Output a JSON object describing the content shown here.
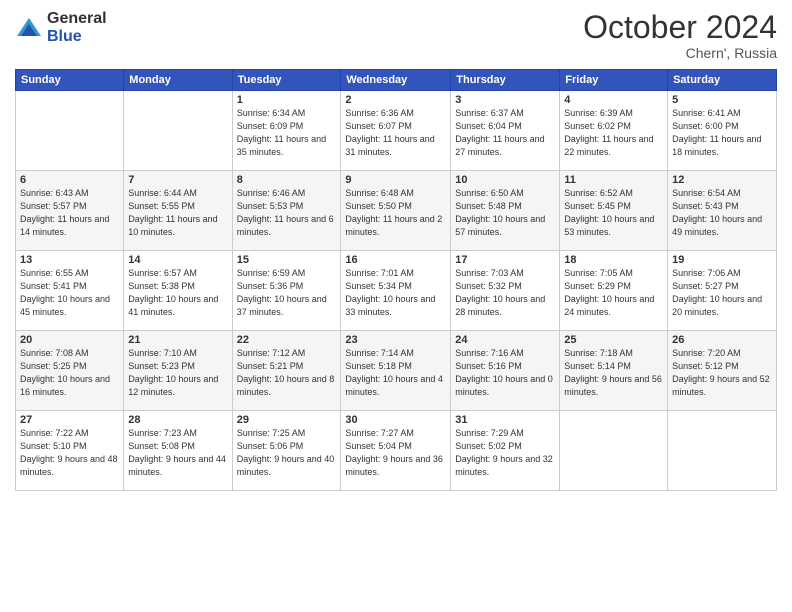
{
  "logo": {
    "general": "General",
    "blue": "Blue"
  },
  "title": "October 2024",
  "subtitle": "Chern', Russia",
  "headers": [
    "Sunday",
    "Monday",
    "Tuesday",
    "Wednesday",
    "Thursday",
    "Friday",
    "Saturday"
  ],
  "weeks": [
    [
      {
        "day": "",
        "info": ""
      },
      {
        "day": "",
        "info": ""
      },
      {
        "day": "1",
        "info": "Sunrise: 6:34 AM\nSunset: 6:09 PM\nDaylight: 11 hours and 35 minutes."
      },
      {
        "day": "2",
        "info": "Sunrise: 6:36 AM\nSunset: 6:07 PM\nDaylight: 11 hours and 31 minutes."
      },
      {
        "day": "3",
        "info": "Sunrise: 6:37 AM\nSunset: 6:04 PM\nDaylight: 11 hours and 27 minutes."
      },
      {
        "day": "4",
        "info": "Sunrise: 6:39 AM\nSunset: 6:02 PM\nDaylight: 11 hours and 22 minutes."
      },
      {
        "day": "5",
        "info": "Sunrise: 6:41 AM\nSunset: 6:00 PM\nDaylight: 11 hours and 18 minutes."
      }
    ],
    [
      {
        "day": "6",
        "info": "Sunrise: 6:43 AM\nSunset: 5:57 PM\nDaylight: 11 hours and 14 minutes."
      },
      {
        "day": "7",
        "info": "Sunrise: 6:44 AM\nSunset: 5:55 PM\nDaylight: 11 hours and 10 minutes."
      },
      {
        "day": "8",
        "info": "Sunrise: 6:46 AM\nSunset: 5:53 PM\nDaylight: 11 hours and 6 minutes."
      },
      {
        "day": "9",
        "info": "Sunrise: 6:48 AM\nSunset: 5:50 PM\nDaylight: 11 hours and 2 minutes."
      },
      {
        "day": "10",
        "info": "Sunrise: 6:50 AM\nSunset: 5:48 PM\nDaylight: 10 hours and 57 minutes."
      },
      {
        "day": "11",
        "info": "Sunrise: 6:52 AM\nSunset: 5:45 PM\nDaylight: 10 hours and 53 minutes."
      },
      {
        "day": "12",
        "info": "Sunrise: 6:54 AM\nSunset: 5:43 PM\nDaylight: 10 hours and 49 minutes."
      }
    ],
    [
      {
        "day": "13",
        "info": "Sunrise: 6:55 AM\nSunset: 5:41 PM\nDaylight: 10 hours and 45 minutes."
      },
      {
        "day": "14",
        "info": "Sunrise: 6:57 AM\nSunset: 5:38 PM\nDaylight: 10 hours and 41 minutes."
      },
      {
        "day": "15",
        "info": "Sunrise: 6:59 AM\nSunset: 5:36 PM\nDaylight: 10 hours and 37 minutes."
      },
      {
        "day": "16",
        "info": "Sunrise: 7:01 AM\nSunset: 5:34 PM\nDaylight: 10 hours and 33 minutes."
      },
      {
        "day": "17",
        "info": "Sunrise: 7:03 AM\nSunset: 5:32 PM\nDaylight: 10 hours and 28 minutes."
      },
      {
        "day": "18",
        "info": "Sunrise: 7:05 AM\nSunset: 5:29 PM\nDaylight: 10 hours and 24 minutes."
      },
      {
        "day": "19",
        "info": "Sunrise: 7:06 AM\nSunset: 5:27 PM\nDaylight: 10 hours and 20 minutes."
      }
    ],
    [
      {
        "day": "20",
        "info": "Sunrise: 7:08 AM\nSunset: 5:25 PM\nDaylight: 10 hours and 16 minutes."
      },
      {
        "day": "21",
        "info": "Sunrise: 7:10 AM\nSunset: 5:23 PM\nDaylight: 10 hours and 12 minutes."
      },
      {
        "day": "22",
        "info": "Sunrise: 7:12 AM\nSunset: 5:21 PM\nDaylight: 10 hours and 8 minutes."
      },
      {
        "day": "23",
        "info": "Sunrise: 7:14 AM\nSunset: 5:18 PM\nDaylight: 10 hours and 4 minutes."
      },
      {
        "day": "24",
        "info": "Sunrise: 7:16 AM\nSunset: 5:16 PM\nDaylight: 10 hours and 0 minutes."
      },
      {
        "day": "25",
        "info": "Sunrise: 7:18 AM\nSunset: 5:14 PM\nDaylight: 9 hours and 56 minutes."
      },
      {
        "day": "26",
        "info": "Sunrise: 7:20 AM\nSunset: 5:12 PM\nDaylight: 9 hours and 52 minutes."
      }
    ],
    [
      {
        "day": "27",
        "info": "Sunrise: 7:22 AM\nSunset: 5:10 PM\nDaylight: 9 hours and 48 minutes."
      },
      {
        "day": "28",
        "info": "Sunrise: 7:23 AM\nSunset: 5:08 PM\nDaylight: 9 hours and 44 minutes."
      },
      {
        "day": "29",
        "info": "Sunrise: 7:25 AM\nSunset: 5:06 PM\nDaylight: 9 hours and 40 minutes."
      },
      {
        "day": "30",
        "info": "Sunrise: 7:27 AM\nSunset: 5:04 PM\nDaylight: 9 hours and 36 minutes."
      },
      {
        "day": "31",
        "info": "Sunrise: 7:29 AM\nSunset: 5:02 PM\nDaylight: 9 hours and 32 minutes."
      },
      {
        "day": "",
        "info": ""
      },
      {
        "day": "",
        "info": ""
      }
    ]
  ]
}
